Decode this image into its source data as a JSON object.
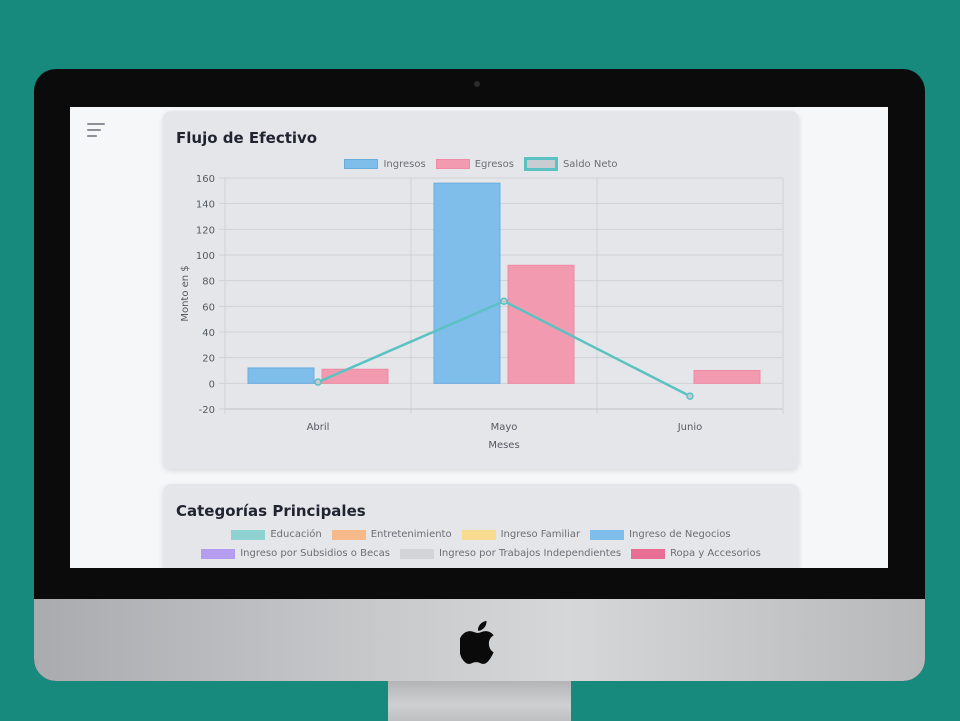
{
  "cashflow": {
    "title": "Flujo de Efectivo",
    "chart_data": {
      "type": "bar",
      "title": "Flujo de Efectivo",
      "categories": [
        "Abril",
        "Mayo",
        "Junio"
      ],
      "series": [
        {
          "name": "Ingresos",
          "type": "bar",
          "values": [
            12,
            156,
            0
          ],
          "color": "#7fbdea",
          "border": "#6aaee0"
        },
        {
          "name": "Egresos",
          "type": "bar",
          "values": [
            11,
            92,
            10
          ],
          "color": "#f29bb0",
          "border": "#ee8aa2"
        },
        {
          "name": "Saldo Neto",
          "type": "line",
          "values": [
            1,
            64,
            -10
          ],
          "color": "#5bc2c4",
          "fill": "#c9ccd0"
        }
      ],
      "xlabel": "Meses",
      "ylabel": "Monto en $",
      "ylim": [
        -20,
        160
      ],
      "yticks": [
        -20,
        0,
        20,
        40,
        60,
        80,
        100,
        120,
        140,
        160
      ],
      "grid": true,
      "legend": "top"
    }
  },
  "categories": {
    "title": "Categorías Principales",
    "legend_rows": [
      [
        {
          "label": "Educación",
          "color": "#8dd1d0"
        },
        {
          "label": "Entretenimiento",
          "color": "#f5b98a"
        },
        {
          "label": "Ingreso Familiar",
          "color": "#f7dc8f"
        },
        {
          "label": "Ingreso de Negocios",
          "color": "#7fbdea"
        }
      ],
      [
        {
          "label": "Ingreso por Subsidios o Becas",
          "color": "#b49cef"
        },
        {
          "label": "Ingreso por Trabajos Independientes",
          "color": "#d3d4d8"
        },
        {
          "label": "Ropa y Accesorios",
          "color": "#e86e96"
        }
      ]
    ]
  },
  "icons": {
    "menu": "hamburger-menu-icon",
    "brand": "apple-logo-icon"
  }
}
